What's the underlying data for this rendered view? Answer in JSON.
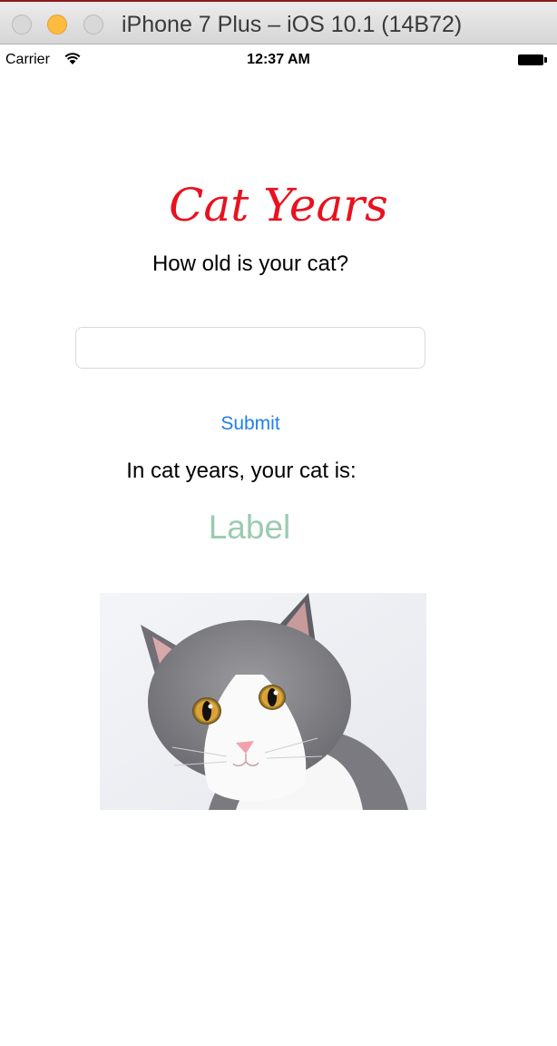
{
  "window": {
    "title": "iPhone 7 Plus – iOS 10.1 (14B72)"
  },
  "status_bar": {
    "carrier": "Carrier",
    "time": "12:37 AM",
    "icons": [
      "wifi-icon",
      "battery-icon"
    ]
  },
  "app": {
    "title": "Cat Years",
    "question": "How old is your cat?",
    "age_input": {
      "value": "",
      "placeholder": ""
    },
    "submit_label": "Submit",
    "result_caption": "In cat years, your cat is:",
    "result_value": "Label",
    "image": "cat-photo"
  },
  "colors": {
    "title": "#e8121f",
    "button": "#1f7ff0",
    "result": "#9acbb0",
    "minimize": "#fdbc40"
  }
}
